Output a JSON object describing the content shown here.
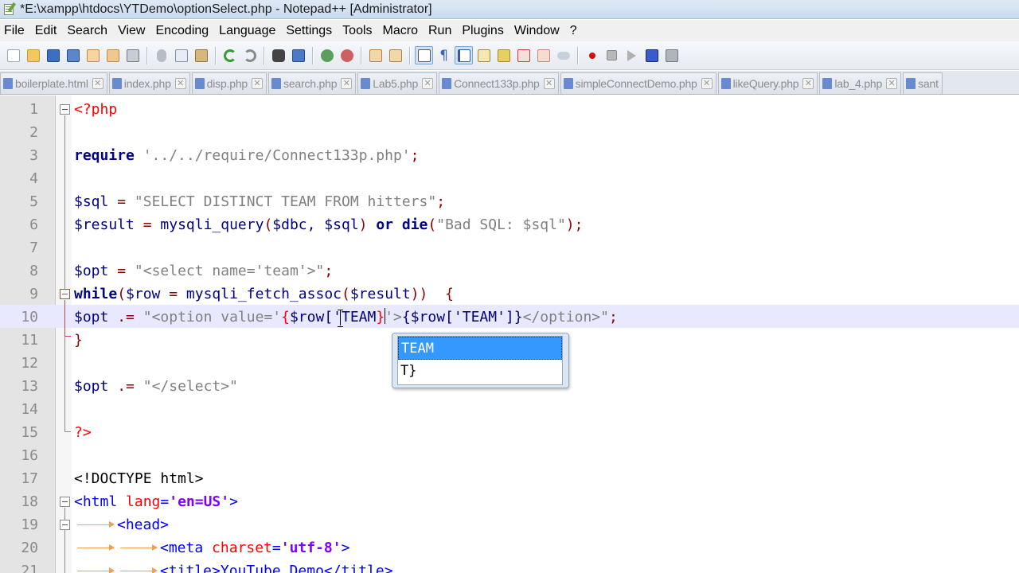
{
  "window": {
    "title": "*E:\\xampp\\htdocs\\YTDemo\\optionSelect.php - Notepad++ [Administrator]"
  },
  "menu": [
    "File",
    "Edit",
    "Search",
    "View",
    "Encoding",
    "Language",
    "Settings",
    "Tools",
    "Macro",
    "Run",
    "Plugins",
    "Window",
    "?"
  ],
  "toolbar": {
    "icons": [
      "new-file-icon",
      "open-file-icon",
      "save-icon",
      "save-all-icon",
      "close-icon",
      "close-all-icon",
      "print-icon",
      "cut-icon",
      "copy-icon",
      "paste-icon",
      "undo-icon",
      "redo-icon",
      "find-icon",
      "replace-icon",
      "zoom-in-icon",
      "zoom-out-icon",
      "sync-vertical-icon",
      "sync-horizontal-icon",
      "word-wrap-icon",
      "show-all-chars-icon",
      "indent-guide-icon",
      "user-lang-icon",
      "doc-map-icon",
      "function-list-icon",
      "folder-workspace-icon",
      "monitoring-icon",
      "record-macro-icon",
      "stop-macro-icon",
      "play-macro-icon",
      "run-macro-multiple-icon",
      "save-macro-icon"
    ]
  },
  "tabs": [
    {
      "label": "boilerplate.html"
    },
    {
      "label": "index.php"
    },
    {
      "label": "disp.php"
    },
    {
      "label": "search.php"
    },
    {
      "label": "Lab5.php"
    },
    {
      "label": "Connect133p.php"
    },
    {
      "label": "simpleConnectDemo.php"
    },
    {
      "label": "likeQuery.php"
    },
    {
      "label": "lab_4.php"
    },
    {
      "label": "sant"
    }
  ],
  "editor": {
    "line_numbers": [
      "1",
      "2",
      "3",
      "4",
      "5",
      "6",
      "7",
      "8",
      "9",
      "10",
      "11",
      "12",
      "13",
      "14",
      "15",
      "16",
      "17",
      "18",
      "19",
      "20",
      "21"
    ],
    "current_line": 10,
    "lines": {
      "l1": "<?php",
      "l3_kw": "require",
      "l3_str": "'../../require/Connect133p.php'",
      "l5_var": "$sql",
      "l5_str": "\"SELECT DISTINCT TEAM FROM hitters\"",
      "l6_var": "$result",
      "l6_fn": "mysqli_query",
      "l6_args": "$dbc, $sql",
      "l6_or": "or",
      "l6_die": "die",
      "l6_str": "\"Bad SQL: $sql\"",
      "l8_var": "$opt",
      "l8_str": "\"<select name='team'>\"",
      "l9_kw": "while",
      "l9_a": "$row",
      "l9_fn": "mysqli_fetch_assoc",
      "l9_b": "$result",
      "l10_var": "$opt",
      "l10_op": ".=",
      "l10_str1": "\"<option value='",
      "l10_b1": "{",
      "l10_mid": "$row['TEAM",
      "l10_b2": "}",
      "l10_str2": "'>",
      "l10_tail": "{$row['TEAM']}",
      "l10_str3": "</option>\"",
      "l11": "}",
      "l13_var": "$opt",
      "l13_str": "\"</select>\"",
      "l15": "?>",
      "l17": "<!DOCTYPE html>",
      "l18_tag": "<html",
      "l18_attr": "lang",
      "l18_val": "'en=US'",
      "l18_close": ">",
      "l19": "<head>",
      "l20_tag": "<meta",
      "l20_attr": "charset",
      "l20_val": "'utf-8'",
      "l20_close": ">",
      "l21": "<title>YouTube Demo</title>"
    }
  },
  "autocomplete": {
    "items": [
      "TEAM",
      "T}"
    ],
    "selected_index": 0
  }
}
